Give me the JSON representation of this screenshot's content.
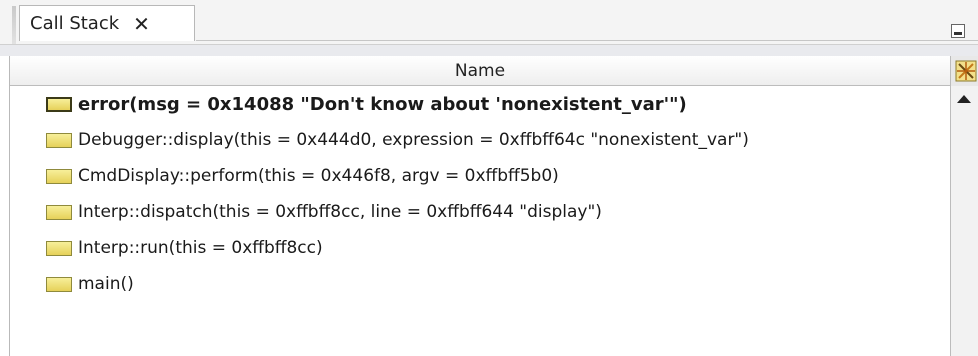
{
  "tab": {
    "title": "Call Stack",
    "close_glyph": "✕"
  },
  "table": {
    "column_header": "Name",
    "rows": [
      {
        "text": "error(msg = 0x14088 \"Don't know about 'nonexistent_var'\")",
        "current": true,
        "icon": "stack-frame-icon"
      },
      {
        "text": "Debugger::display(this = 0x444d0, expression = 0xffbff64c \"nonexistent_var\")",
        "current": false,
        "icon": "stack-frame-icon"
      },
      {
        "text": "CmdDisplay::perform(this = 0x446f8, argv = 0xffbff5b0)",
        "current": false,
        "icon": "stack-frame-icon"
      },
      {
        "text": "Interp::dispatch(this = 0xffbff8cc, line = 0xffbff644 \"display\")",
        "current": false,
        "icon": "stack-frame-icon"
      },
      {
        "text": "Interp::run(this = 0xffbff8cc)",
        "current": false,
        "icon": "stack-frame-icon"
      },
      {
        "text": "main()",
        "current": false,
        "icon": "stack-frame-icon"
      }
    ]
  },
  "colors": {
    "frame_icon": "#ecd96a",
    "frame_icon_border": "#8f8a3c"
  }
}
